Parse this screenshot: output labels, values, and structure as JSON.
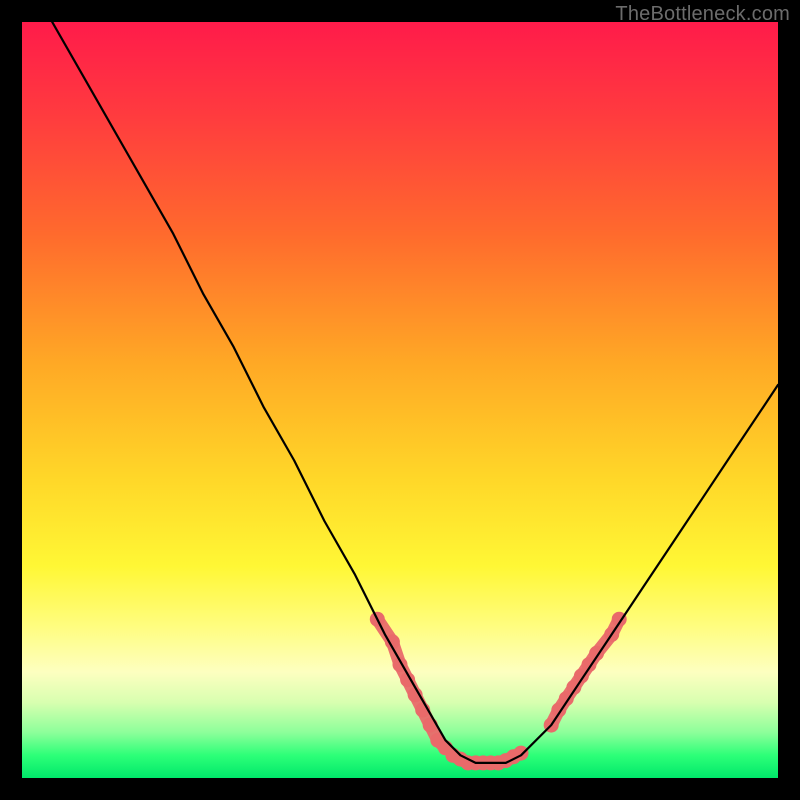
{
  "watermark": "TheBottleneck.com",
  "colors": {
    "background": "#000000",
    "curve_stroke": "#000000",
    "highlight": "#e96a6a",
    "gradient_top": "#ff1b4a",
    "gradient_bottom": "#00e86a"
  },
  "chart_data": {
    "type": "line",
    "title": "",
    "xlabel": "",
    "ylabel": "",
    "xlim": [
      0,
      100
    ],
    "ylim": [
      0,
      100
    ],
    "grid": false,
    "series": [
      {
        "name": "bottleneck-curve",
        "x": [
          4,
          8,
          12,
          16,
          20,
          24,
          28,
          32,
          36,
          40,
          44,
          48,
          52,
          56,
          58,
          60,
          62,
          64,
          66,
          70,
          74,
          78,
          82,
          86,
          90,
          94,
          98,
          100
        ],
        "y": [
          100,
          93,
          86,
          79,
          72,
          64,
          57,
          49,
          42,
          34,
          27,
          19,
          12,
          5,
          3,
          2,
          2,
          2,
          3,
          7,
          13,
          19,
          25,
          31,
          37,
          43,
          49,
          52
        ]
      }
    ],
    "highlight_segments": [
      {
        "name": "left-entry",
        "points": [
          {
            "x": 47,
            "y": 21
          },
          {
            "x": 49,
            "y": 18
          },
          {
            "x": 50,
            "y": 15
          },
          {
            "x": 51,
            "y": 13
          },
          {
            "x": 52,
            "y": 11
          },
          {
            "x": 53,
            "y": 9
          },
          {
            "x": 54,
            "y": 7
          },
          {
            "x": 55,
            "y": 5
          },
          {
            "x": 56,
            "y": 4
          }
        ]
      },
      {
        "name": "valley-floor",
        "points": [
          {
            "x": 57,
            "y": 3
          },
          {
            "x": 58,
            "y": 2.5
          },
          {
            "x": 59,
            "y": 2
          },
          {
            "x": 60,
            "y": 2
          },
          {
            "x": 61,
            "y": 2
          },
          {
            "x": 62,
            "y": 2
          },
          {
            "x": 63,
            "y": 2
          },
          {
            "x": 64,
            "y": 2.3
          },
          {
            "x": 65,
            "y": 2.8
          },
          {
            "x": 66,
            "y": 3.3
          }
        ]
      },
      {
        "name": "right-exit",
        "points": [
          {
            "x": 70,
            "y": 7
          },
          {
            "x": 71,
            "y": 9
          },
          {
            "x": 72,
            "y": 10.5
          },
          {
            "x": 73,
            "y": 12
          },
          {
            "x": 74,
            "y": 13.5
          },
          {
            "x": 75,
            "y": 15
          },
          {
            "x": 76,
            "y": 16.5
          },
          {
            "x": 78,
            "y": 19
          },
          {
            "x": 79,
            "y": 21
          }
        ]
      }
    ]
  }
}
